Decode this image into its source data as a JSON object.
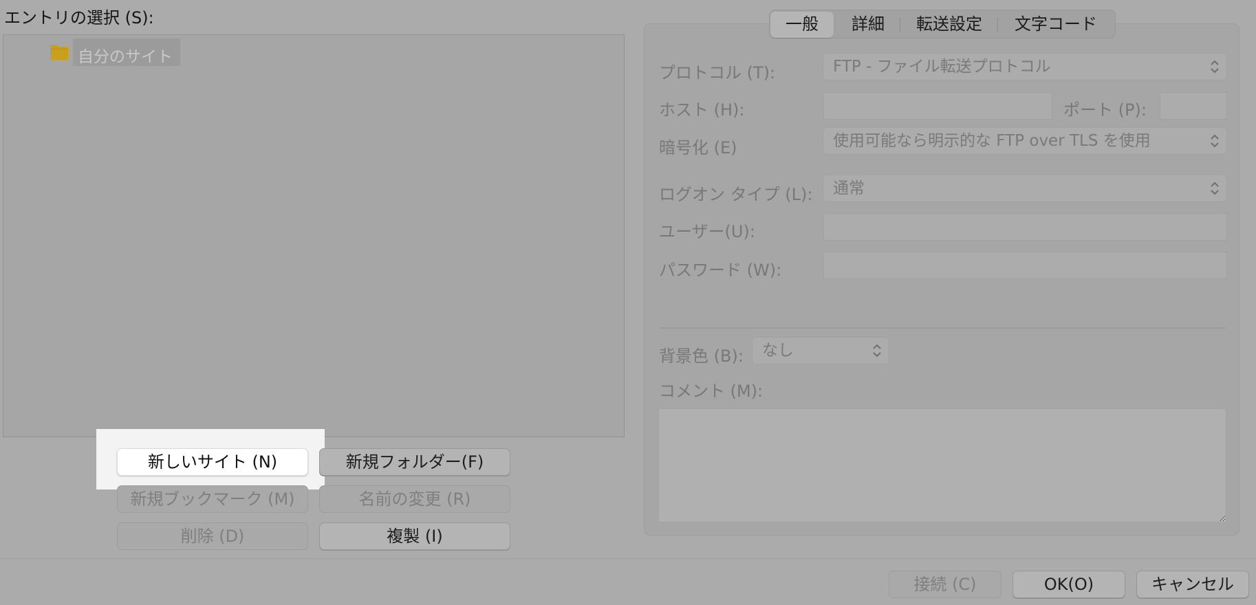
{
  "entry_section": {
    "label": "エントリの選択 (S):",
    "tree": {
      "site_folder": {
        "label": "自分のサイト",
        "icon": "folder-icon"
      }
    },
    "buttons": {
      "new_site": "新しいサイト (N)",
      "new_folder": "新規フォルダー(F)",
      "new_bookmark": "新規ブックマーク (M)",
      "rename": "名前の変更 (R)",
      "delete": "削除 (D)",
      "duplicate": "複製 (I)"
    }
  },
  "settings": {
    "tabs": [
      {
        "label": "一般",
        "active": true
      },
      {
        "label": "詳細"
      },
      {
        "label": "転送設定"
      },
      {
        "label": "文字コード"
      }
    ],
    "protocol": {
      "label": "プロトコル (T):",
      "value": "FTP - ファイル転送プロトコル"
    },
    "host": {
      "label": "ホスト (H):",
      "value": ""
    },
    "port": {
      "label": "ポート (P):",
      "value": ""
    },
    "encryption": {
      "label": "暗号化 (E)",
      "value": "使用可能なら明示的な FTP over TLS を使用"
    },
    "logon_type": {
      "label": "ログオン タイプ (L):",
      "value": "通常"
    },
    "user": {
      "label": "ユーザー(U):",
      "value": ""
    },
    "password": {
      "label": "パスワード (W):",
      "value": ""
    },
    "background_color": {
      "label": "背景色 (B):",
      "value": "なし"
    },
    "comment": {
      "label": "コメント (M):",
      "value": ""
    }
  },
  "footer": {
    "connect": "接続 (C)",
    "ok": "OK(O)",
    "cancel": "キャンセル"
  },
  "colors": {
    "dim_overlay": "#ababab",
    "highlight": "#ffffff",
    "folder": "#c9a01c"
  }
}
